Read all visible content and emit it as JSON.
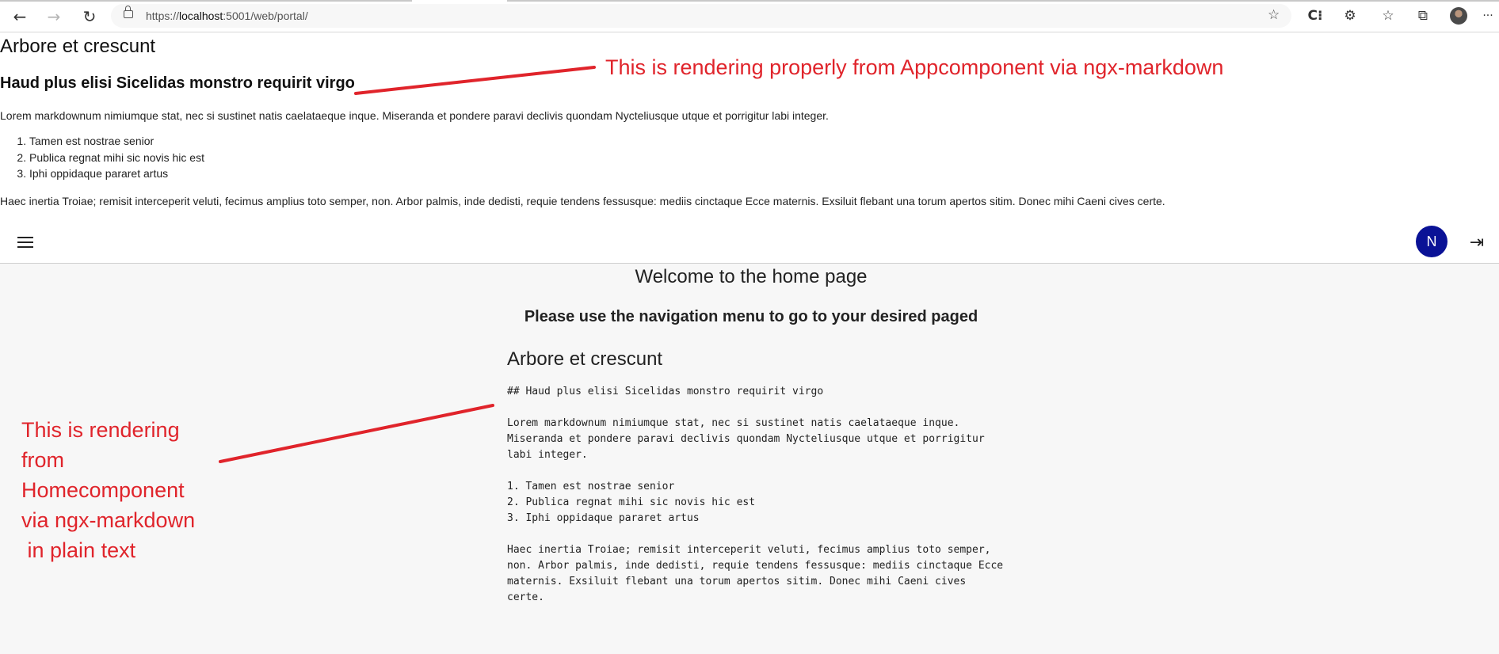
{
  "browser": {
    "url_protocol": "https://",
    "url_host": "localhost",
    "url_rest": ":5001/web/portal/",
    "icons": {
      "back": "arrow-left-icon",
      "forward": "arrow-right-icon",
      "reload": "reload-icon",
      "lock": "lock-icon",
      "favorite": "star-plus-icon",
      "extension": "extension-icon",
      "puzzle": "puzzle-icon",
      "favorites": "favorites-list-icon",
      "collections": "collections-icon",
      "profile": "profile-avatar-icon",
      "more": "more-icon"
    },
    "more_glyph": "···"
  },
  "app_markdown": {
    "h1": "Arbore et crescunt",
    "h2": "Haud plus elisi Sicelidas monstro requirit virgo",
    "p1": "Lorem markdownum nimiumque stat, nec si sustinet natis caelataeque inque. Miseranda et pondere paravi declivis quondam Nycteliusque utque et porrigitur labi integer.",
    "list": [
      "Tamen est nostrae senior",
      "Publica regnat mihi sic novis hic est",
      "Iphi oppidaque pararet artus"
    ],
    "p2": "Haec inertia Troiae; remisit interceperit veluti, fecimus amplius toto semper, non. Arbor palmis, inde dedisti, requie tendens fessusque: mediis cinctaque Ecce maternis. Exsiluit flebant una torum apertos sitim. Donec mihi Caeni cives certe."
  },
  "toolbar": {
    "avatar_letter": "N",
    "avatar_color": "#0a1296"
  },
  "home": {
    "title": "Welcome to the home page",
    "subtitle": "Please use the navigation menu to go to your desired paged",
    "md_h1": "Arbore et crescunt",
    "md_raw": "## Haud plus elisi Sicelidas monstro requirit virgo\n\nLorem markdownum nimiumque stat, nec si sustinet natis caelataeque inque.\nMiseranda et pondere paravi declivis quondam Nycteliusque utque et porrigitur\nlabi integer.\n\n1. Tamen est nostrae senior\n2. Publica regnat mihi sic novis hic est\n3. Iphi oppidaque pararet artus\n\nHaec inertia Troiae; remisit interceperit veluti, fecimus amplius toto semper,\nnon. Arbor palmis, inde dedisti, requie tendens fessusque: mediis cinctaque Ecce\nmaternis. Exsiluit flebant una torum apertos sitim. Donec mihi Caeni cives\ncerte."
  },
  "annotations": {
    "note1": "This is rendering properly from Appcomponent via ngx-markdown",
    "note2_lines": [
      "This is rendering",
      "from",
      "Homecomponent",
      "via ngx-markdown",
      " in plain text"
    ],
    "color": "#e0242b"
  }
}
